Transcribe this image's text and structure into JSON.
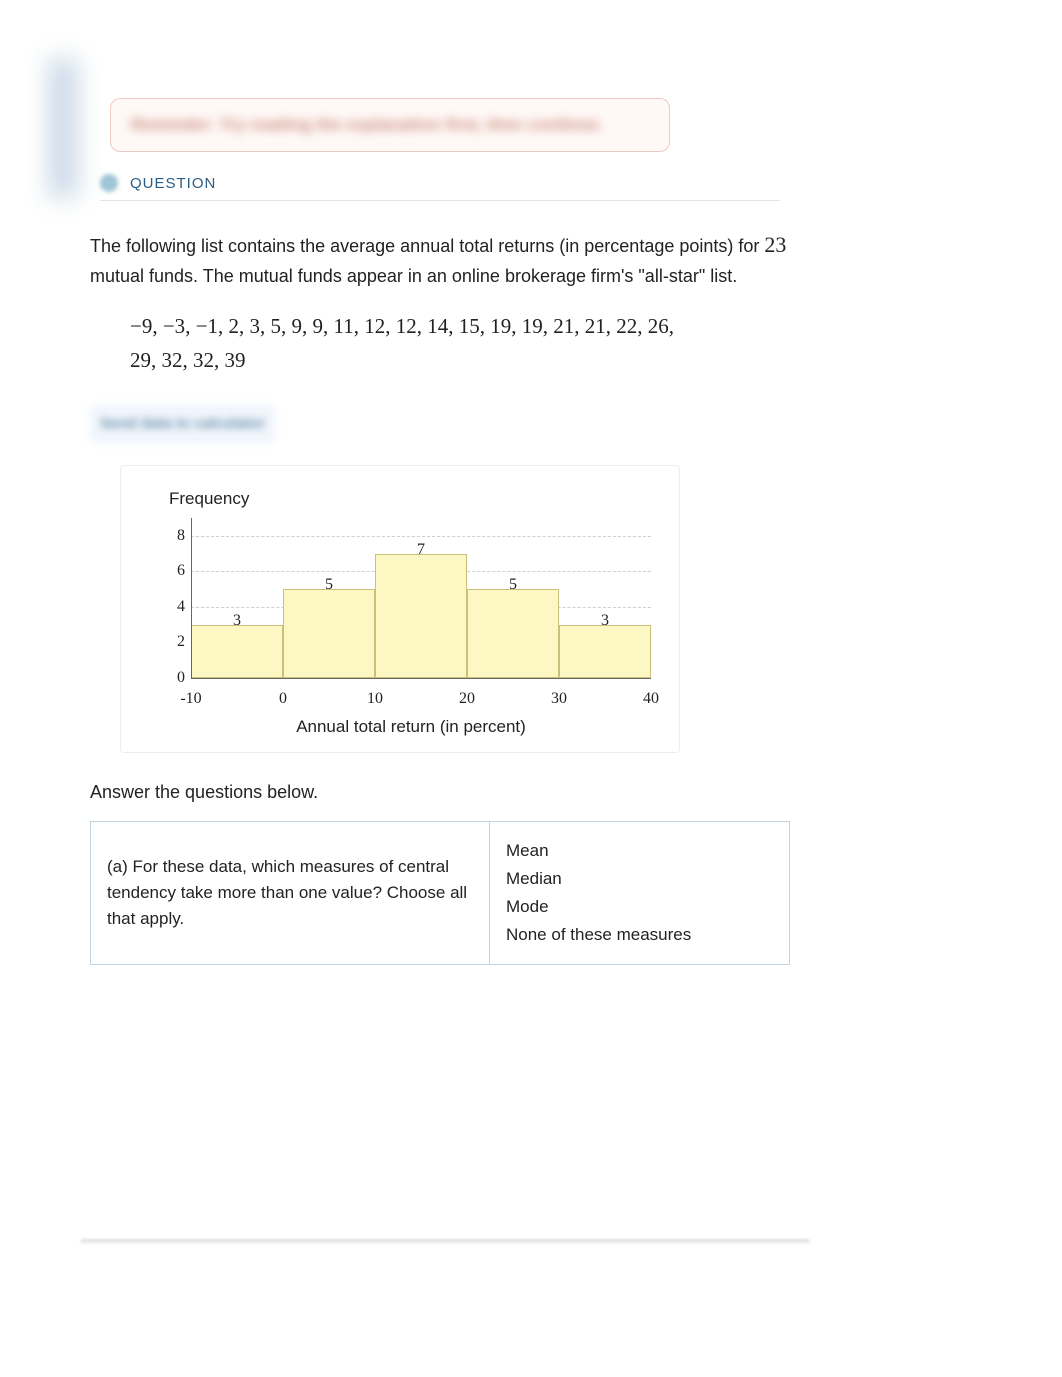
{
  "hint": "Reminder: Try reading the explanation first, then continue.",
  "section_label": "QUESTION",
  "question": {
    "intro_before": "The following list contains the average annual total returns (in percentage points) for ",
    "count": "23",
    "intro_after": " mutual funds. The mutual funds appear in an online brokerage firm's \"all-star\" list."
  },
  "data_values": [
    "−9",
    "−3",
    "−1",
    "2",
    "3",
    "5",
    "9",
    "9",
    "11",
    "12",
    "12",
    "14",
    "15",
    "19",
    "19",
    "21",
    "21",
    "22",
    "26",
    "29",
    "32",
    "32",
    "39"
  ],
  "blur_link": "Send data to calculator",
  "answer_prompt": "Answer the questions below.",
  "qa": {
    "prompt": "(a) For these data, which measures of central tendency take more than one value? Choose all that apply.",
    "options": [
      "Mean",
      "Median",
      "Mode",
      "None of these measures"
    ]
  },
  "chart_data": {
    "type": "bar",
    "ylabel": "Frequency",
    "xlabel": "Annual total return (in percent)",
    "ylim": [
      0,
      9
    ],
    "yticks": [
      0,
      2,
      4,
      6,
      8
    ],
    "xticks": [
      -10,
      0,
      10,
      20,
      30,
      40
    ],
    "bin_edges": [
      -10,
      0,
      10,
      20,
      30,
      40
    ],
    "values": [
      3,
      5,
      7,
      5,
      3
    ],
    "bar_labels": [
      "3",
      "5",
      "7",
      "5",
      "3"
    ]
  }
}
